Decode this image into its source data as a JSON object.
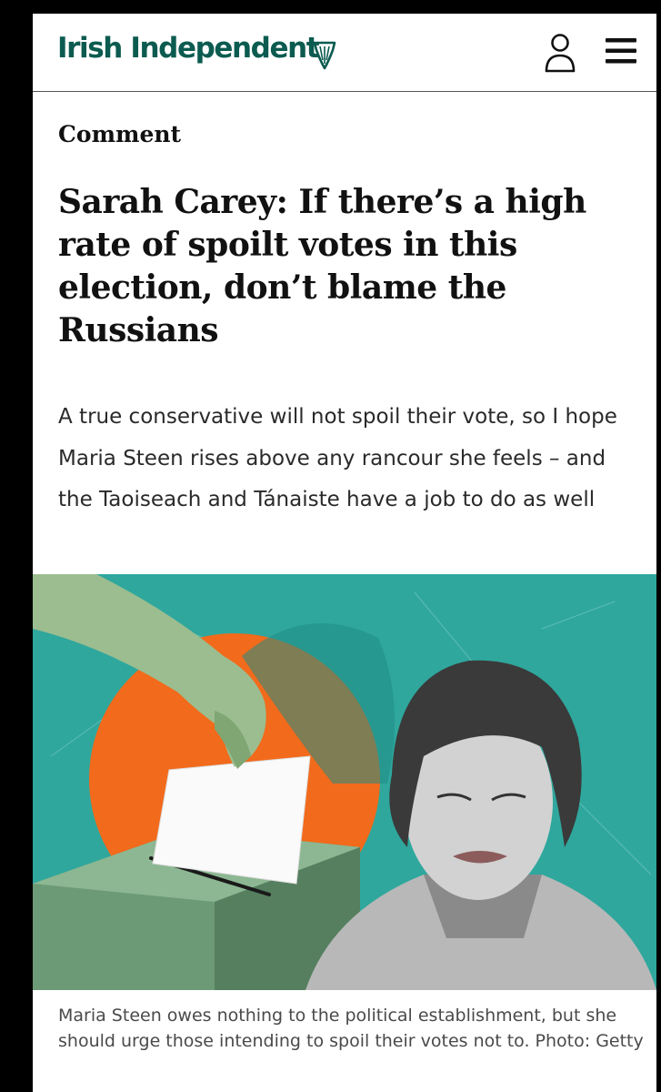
{
  "header": {
    "logo_text": "Irish Independent",
    "brand_color": "#0c5b50",
    "icons": [
      "harp-icon",
      "account-icon",
      "menu-icon"
    ]
  },
  "article": {
    "section": "Comment",
    "headline": "Sarah Carey: If there’s a high rate of spoilt votes in this election, don’t blame the Russians",
    "standfirst": "A true conservative will not spoil their vote, so I hope Maria Steen rises above any rancour she feels – and the Taoiseach and Tánaiste have a job to do as well"
  },
  "image": {
    "caption": "Maria Steen owes nothing to the political establishment, but she should urge those intending to spoil their votes not to. Photo: Getty"
  },
  "colors": {
    "teal": "#2fa79d",
    "orange": "#f26a1b",
    "ballot_box": "#6d9a76"
  }
}
